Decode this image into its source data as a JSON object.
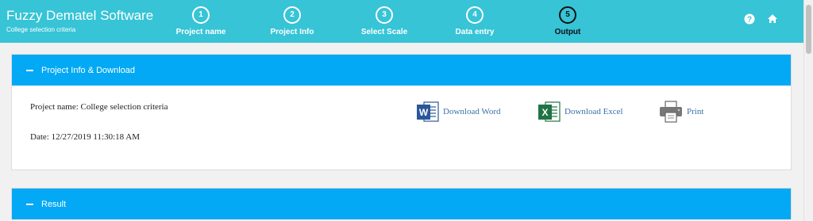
{
  "app": {
    "title": "Fuzzy Dematel Software",
    "subtitle": "College selection criteria"
  },
  "steps": [
    {
      "number": "1",
      "label": "Project name"
    },
    {
      "number": "2",
      "label": "Project Info"
    },
    {
      "number": "3",
      "label": "Select Scale"
    },
    {
      "number": "4",
      "label": "Data entry"
    },
    {
      "number": "5",
      "label": "Output"
    }
  ],
  "header_icons": [
    "help-icon",
    "home-icon"
  ],
  "project_panel": {
    "title": "Project Info & Download",
    "project_name": "Project name: College selection criteria",
    "date": "Date: 12/27/2019 11:30:18 AM",
    "download_word": "Download Word",
    "download_excel": "Download Excel",
    "print": "Print"
  },
  "result_panel": {
    "title": "Result"
  },
  "colors": {
    "header": "#36c4d6",
    "panel_header": "#03a9f4",
    "word": "#2b579a",
    "excel": "#217346",
    "link": "#3a6fa8"
  }
}
